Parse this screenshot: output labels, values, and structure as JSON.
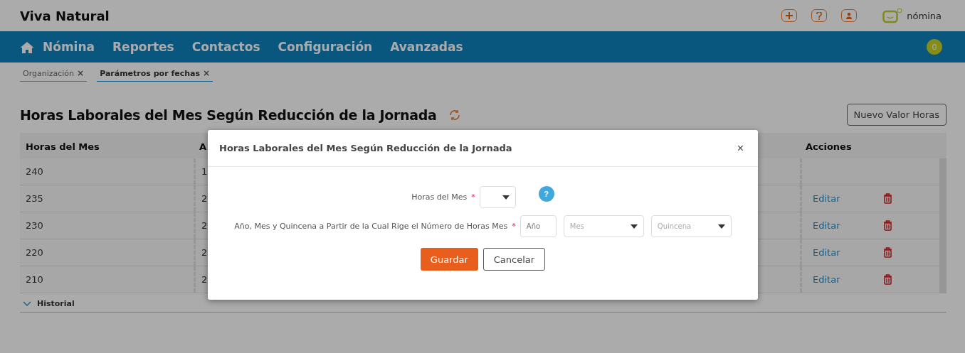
{
  "app": {
    "title": "Viva Natural",
    "brand": "nómina"
  },
  "header_icons": [
    {
      "kind": "plus"
    },
    {
      "kind": "help"
    },
    {
      "kind": "user"
    }
  ],
  "nav": {
    "items": [
      {
        "label": "Nómina",
        "kind": "home"
      },
      {
        "label": "Reportes",
        "kind": "plain"
      },
      {
        "label": "Contactos",
        "kind": "plain"
      },
      {
        "label": "Configuración",
        "kind": "plain"
      },
      {
        "label": "Avanzadas",
        "kind": "plain"
      }
    ],
    "badge": "0"
  },
  "breadcrumbs": [
    {
      "label": "Organización",
      "close": "×",
      "selected": false
    },
    {
      "label": "Parámetros por fechas",
      "close": "×",
      "selected": true
    }
  ],
  "page": {
    "title": "Horas Laborales del Mes Según Reducción de la Jornada",
    "new_button": "Nuevo Valor Horas"
  },
  "table": {
    "columns": [
      "Horas del Mes",
      "A",
      "Acciones"
    ],
    "rows": [
      {
        "hours": "240",
        "column_2": "1",
        "deletable": false
      },
      {
        "hours": "235",
        "column_2": "2",
        "edit": "Editar",
        "deletable": true
      },
      {
        "hours": "230",
        "column_2": "2",
        "edit": "Editar",
        "deletable": true
      },
      {
        "hours": "220",
        "column_2": "2",
        "edit": "Editar",
        "deletable": true
      },
      {
        "hours": "210",
        "column_2": "2",
        "edit": "Editar",
        "deletable": true
      }
    ]
  },
  "history": {
    "label": "Historial"
  },
  "modal": {
    "title": "Horas Laborales del Mes Según Reducción de la Jornada",
    "close": "×",
    "fields": [
      {
        "label": "Horas del Mes",
        "required_mark": "*",
        "help": "?",
        "inputs": [
          {
            "kind": "select"
          }
        ]
      },
      {
        "label": "Año, Mes y Quincena a Partir de la Cual Rige el Número de Horas Mes",
        "required_mark": "*",
        "inputs": [
          {
            "kind": "text",
            "placeholder": "Año"
          },
          {
            "kind": "select",
            "placeholder": "Mes"
          },
          {
            "kind": "select",
            "placeholder": "Quincena"
          }
        ]
      }
    ],
    "buttons": [
      {
        "label": "Guardar",
        "kind": "primary"
      },
      {
        "label": "Cancelar",
        "kind": "secondary"
      }
    ]
  }
}
